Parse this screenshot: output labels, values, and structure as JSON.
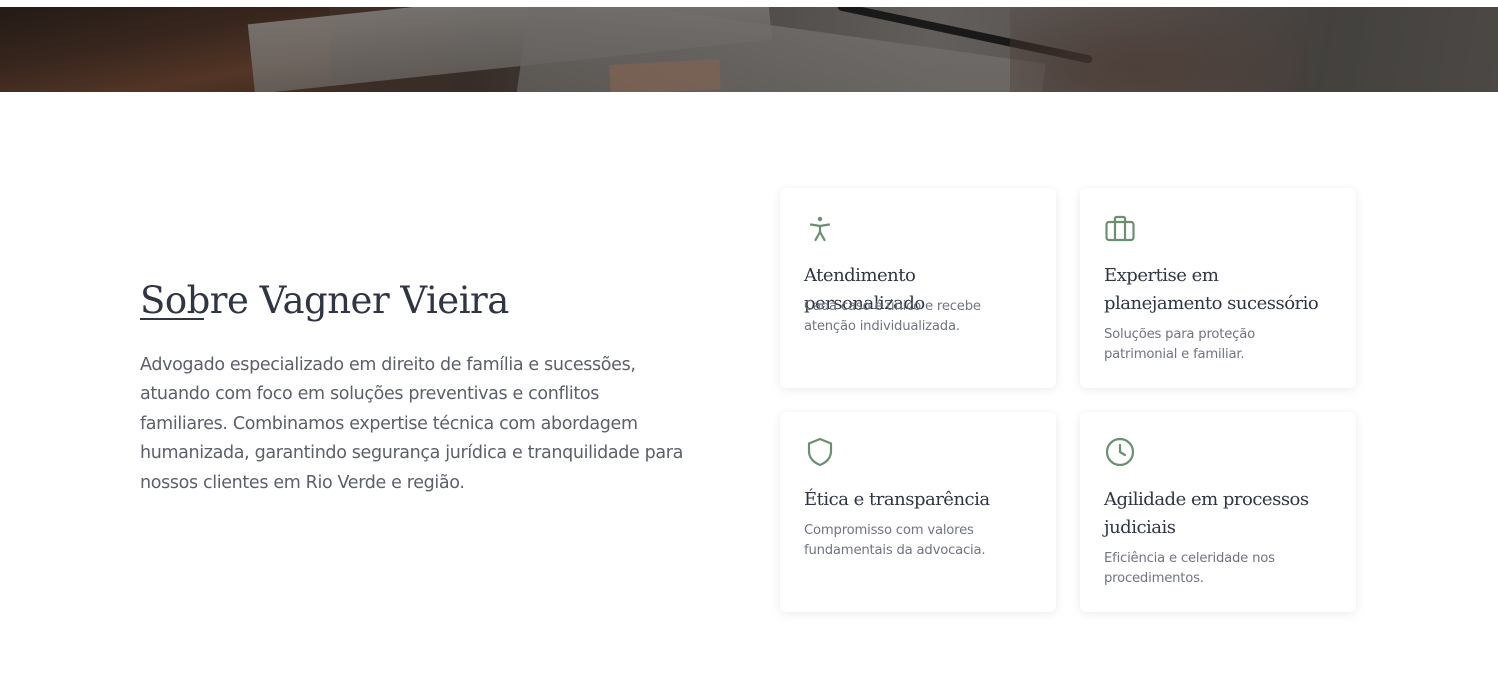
{
  "about": {
    "title": "Sobre Vagner Vieira",
    "text": "Advogado especializado em direito de família e sucessões, atuando com foco em soluções preventivas e conflitos familiares. Combinamos expertise técnica com abordagem humanizada, garantindo segurança jurídica e tranquilidade para nossos clientes em Rio Verde e região."
  },
  "accent_color": "#6b8f71",
  "features": [
    {
      "icon": "accessibility-icon",
      "title": "Atendimento personalizado",
      "description": "Cada caso é único e recebe atenção individualizada."
    },
    {
      "icon": "briefcase-icon",
      "title": "Expertise em planejamento sucessório",
      "description": "Soluções para proteção patrimonial e familiar."
    },
    {
      "icon": "shield-icon",
      "title": "Ética e transparência",
      "description": "Compromisso com valores fundamentais da advocacia."
    },
    {
      "icon": "clock-icon",
      "title": "Agilidade em processos judiciais",
      "description": "Eficiência e celeridade nos procedimentos."
    }
  ]
}
